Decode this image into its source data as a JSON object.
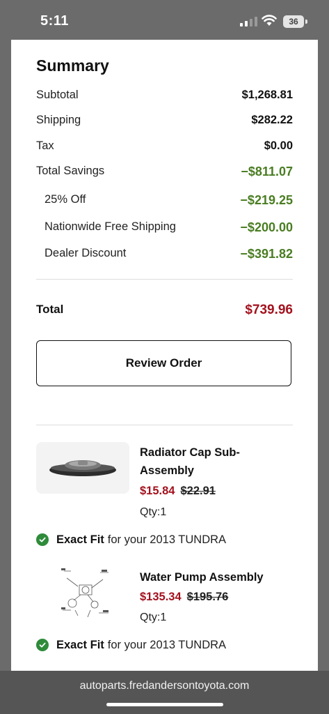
{
  "status_bar": {
    "time": "5:11",
    "battery": "36"
  },
  "summary": {
    "title": "Summary",
    "rows": [
      {
        "label": "Subtotal",
        "value": "$1,268.81"
      },
      {
        "label": "Shipping",
        "value": "$282.22"
      },
      {
        "label": "Tax",
        "value": "$0.00"
      },
      {
        "label": "Total Savings",
        "value": "−$811.07"
      },
      {
        "label": "25% Off",
        "value": "−$219.25"
      },
      {
        "label": "Nationwide Free Shipping",
        "value": "−$200.00"
      },
      {
        "label": "Dealer Discount",
        "value": "−$391.82"
      }
    ],
    "total_label": "Total",
    "total_value": "$739.96",
    "review_button": "Review Order"
  },
  "items": [
    {
      "name": "Radiator Cap Sub-Assembly",
      "price": "$15.84",
      "original_price": "$22.91",
      "qty": "Qty:1",
      "fit_strong": "Exact Fit",
      "fit_rest": "for your 2013 TUNDRA"
    },
    {
      "name": "Water Pump Assembly",
      "price": "$135.34",
      "original_price": "$195.76",
      "qty": "Qty:1",
      "fit_strong": "Exact Fit",
      "fit_rest": "for your 2013 TUNDRA"
    }
  ],
  "url_bar": {
    "url": "autoparts.fredandersontoyota.com"
  },
  "colors": {
    "savings_green": "#4a7d22",
    "price_red": "#a3121e",
    "fit_check_green": "#2e8b3a"
  }
}
